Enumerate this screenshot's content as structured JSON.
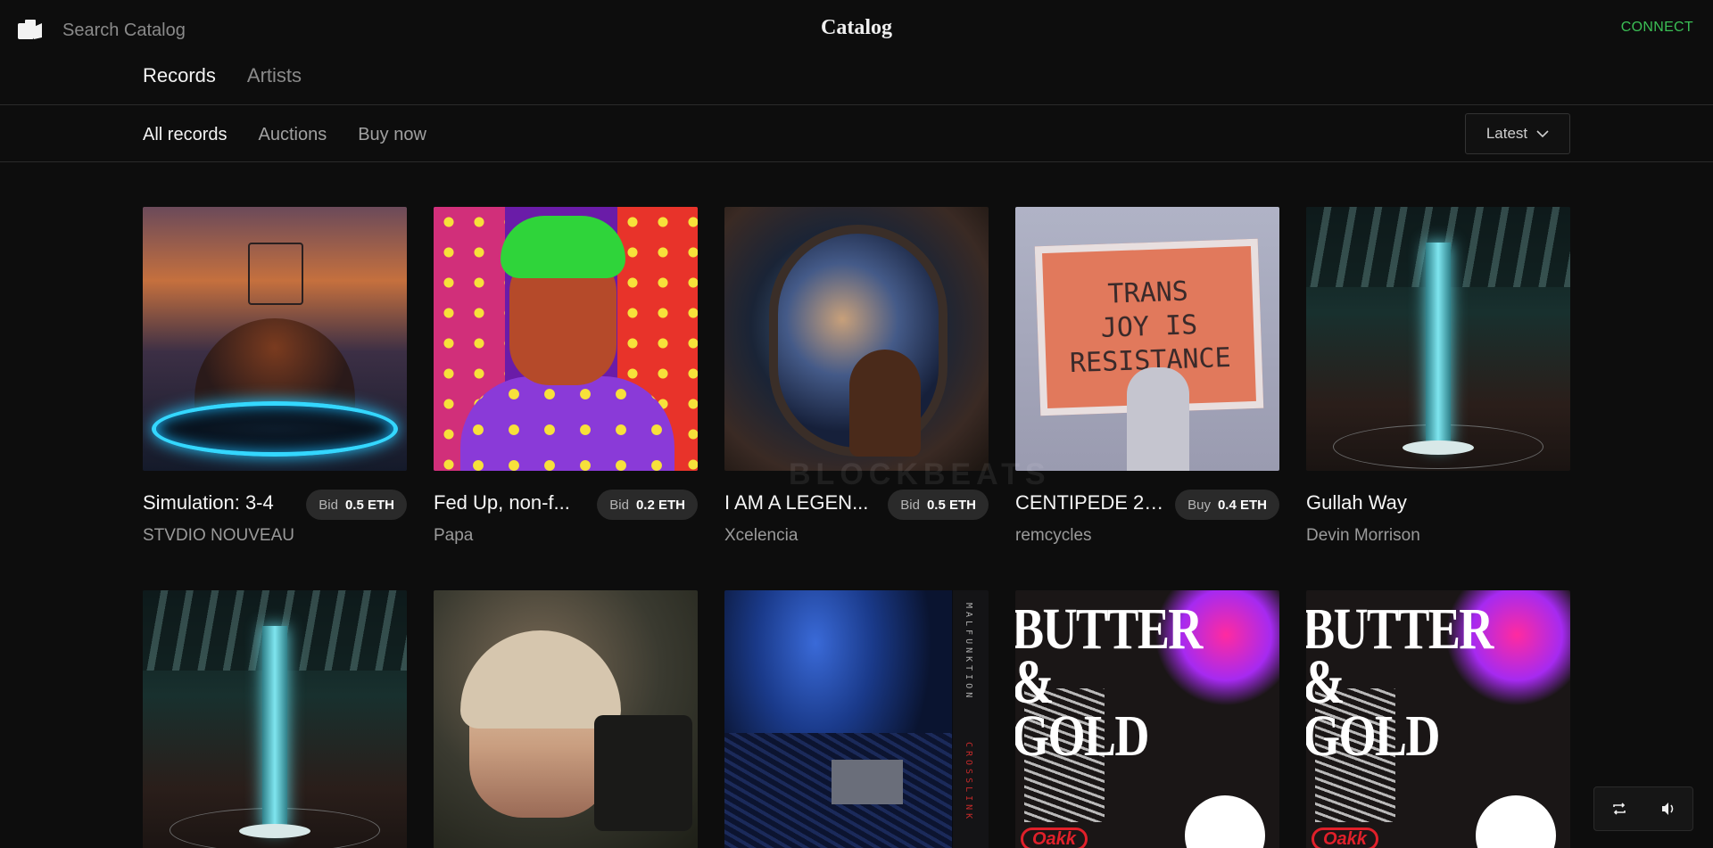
{
  "header": {
    "search_placeholder": "Search Catalog",
    "title": "Catalog",
    "connect_label": "CONNECT"
  },
  "main_tabs": [
    {
      "label": "Records",
      "active": true
    },
    {
      "label": "Artists",
      "active": false
    }
  ],
  "sub_tabs": [
    {
      "label": "All records",
      "active": true
    },
    {
      "label": "Auctions",
      "active": false
    },
    {
      "label": "Buy now",
      "active": false
    }
  ],
  "sort": {
    "label": "Latest",
    "icon": "chevron-down-icon"
  },
  "records": [
    {
      "title": "Simulation: 3-4",
      "artist": "STVDIO NOUVEAU",
      "kind": "Bid",
      "price": "0.5 ETH"
    },
    {
      "title": "Fed Up, non-f...",
      "artist": "Papa",
      "kind": "Bid",
      "price": "0.2 ETH"
    },
    {
      "title": "I AM A LEGEN...",
      "artist": "Xcelencia",
      "kind": "Bid",
      "price": "0.5 ETH"
    },
    {
      "title": "CENTIPEDE 2....",
      "artist": "remcycles",
      "kind": "Buy",
      "price": "0.4 ETH"
    },
    {
      "title": "Gullah Way",
      "artist": "Devin Morrison",
      "kind": "",
      "price": ""
    }
  ],
  "art_text": {
    "sign": [
      "TRANS",
      "JOY IS",
      "RESISTANCE"
    ],
    "strip_top": "MALFUNKTION",
    "strip_bottom": "CROSSLINK",
    "butter_line1": "BUTTER",
    "butter_line2": "&",
    "butter_line3": "GOLD",
    "oakk": "Oakk"
  },
  "watermark": "BLOCKBEATS",
  "controls": {
    "repeat_icon": "repeat-icon",
    "volume_icon": "volume-icon"
  },
  "colors": {
    "accent_connect": "#3bbf55",
    "background": "#0d0d0d",
    "pill": "#2a2a2a"
  }
}
